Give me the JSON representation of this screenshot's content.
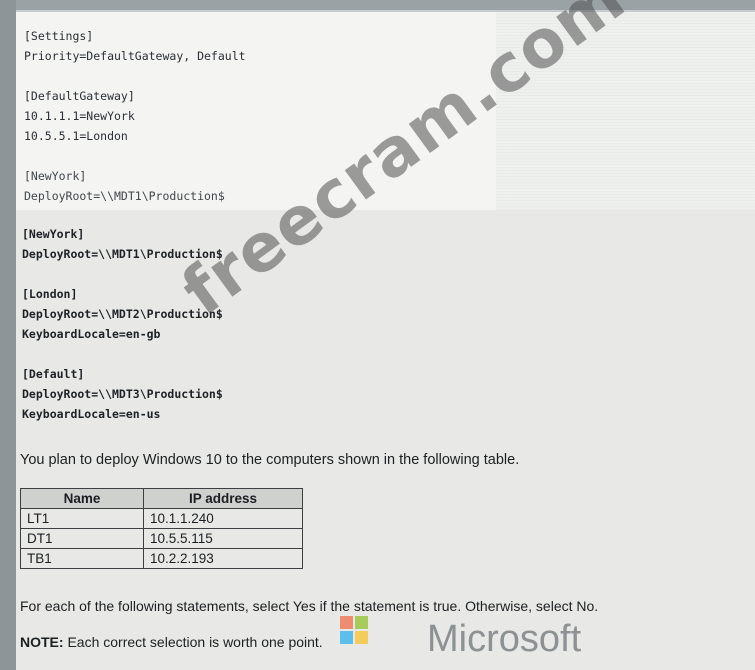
{
  "top_block": {
    "lines": [
      "[Settings]",
      "Priority=DefaultGateway, Default",
      "",
      "[DefaultGateway]",
      "10.1.1.1=NewYork",
      "10.5.5.1=London",
      "",
      "[NewYork]",
      "DeployRoot=\\\\MDT1\\Production$"
    ]
  },
  "bottom_block": {
    "newyork": [
      "[NewYork]",
      "DeployRoot=\\\\MDT1\\Production$"
    ],
    "london": [
      "[London]",
      "DeployRoot=\\\\MDT2\\Production$",
      "KeyboardLocale=en-gb"
    ],
    "default": [
      "[Default]",
      "DeployRoot=\\\\MDT3\\Production$",
      "KeyboardLocale=en-us"
    ]
  },
  "intro": "You plan to deploy Windows 10 to the computers shown in the following table.",
  "table": {
    "headers": [
      "Name",
      "IP address"
    ],
    "rows": [
      [
        "LT1",
        "10.1.1.240"
      ],
      [
        "DT1",
        "10.5.5.115"
      ],
      [
        "TB1",
        "10.2.2.193"
      ]
    ]
  },
  "instruction": "For each of the following statements, select Yes if the statement is true. Otherwise, select No.",
  "note_label": "NOTE:",
  "note_text": " Each correct selection is worth one point.",
  "watermark": "freecram.com",
  "brand": {
    "text": "Microsoft",
    "logo_colors": [
      "#f25022",
      "#7fba00",
      "#00a4ef",
      "#ffb900"
    ]
  }
}
